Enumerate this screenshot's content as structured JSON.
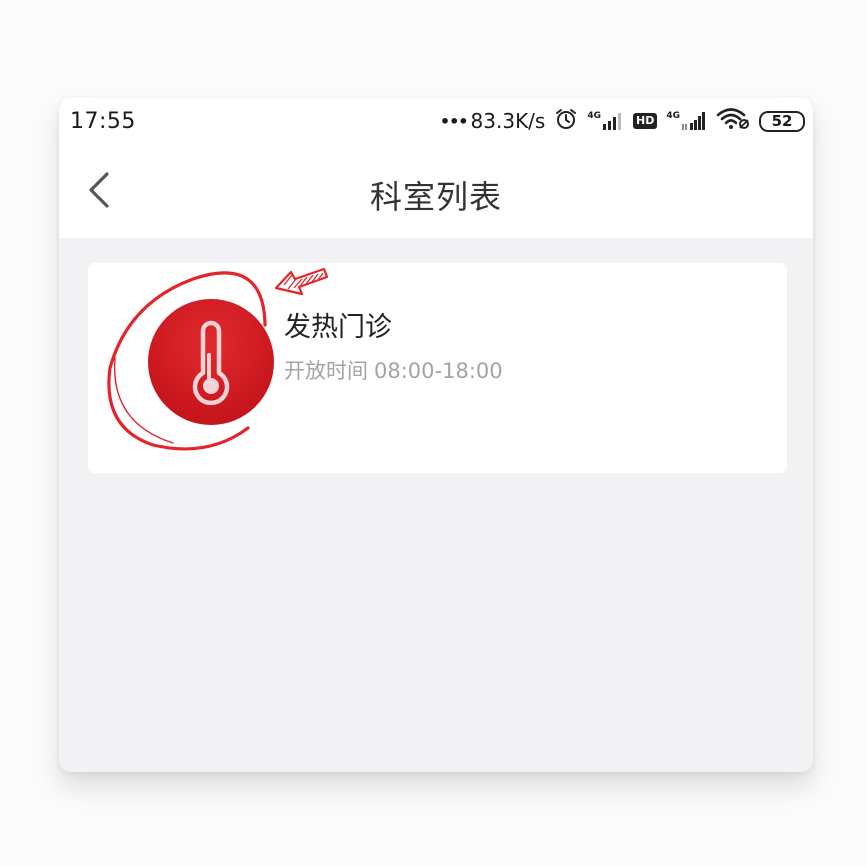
{
  "status_bar": {
    "time": "17:55",
    "dots": "•••",
    "net_speed": "83.3K/s",
    "sim1_label": "4G",
    "hd_label": "HD",
    "sim2_label": "4G",
    "battery": "52"
  },
  "header": {
    "title": "科室列表"
  },
  "departments": [
    {
      "name": "发热门诊",
      "hours_label": "开放时间",
      "hours": "08:00-18:00",
      "icon": "thermometer-icon"
    }
  ],
  "colors": {
    "accent_red": "#c8161d",
    "annotation_red": "#e3252b",
    "background": "#f2f2f4"
  }
}
